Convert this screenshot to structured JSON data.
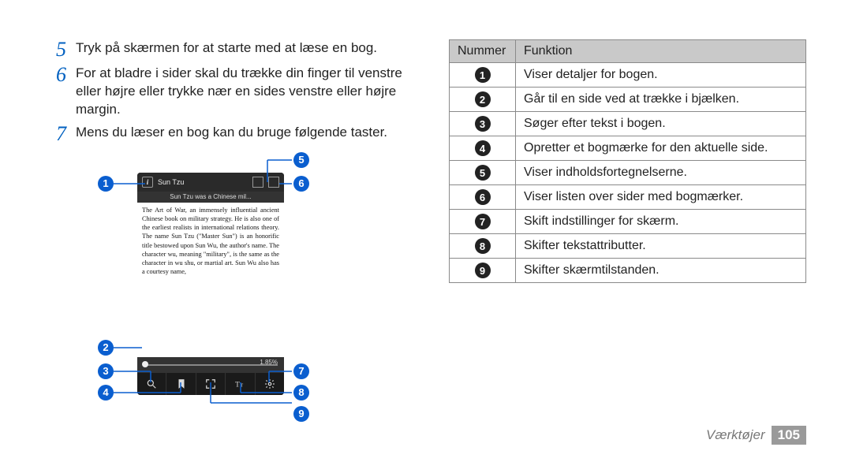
{
  "steps": [
    {
      "num": "5",
      "text": "Tryk på skærmen for at starte med at læse en bog."
    },
    {
      "num": "6",
      "text": "For at bladre i sider skal du trække din finger til venstre eller højre eller trykke nær en sides venstre eller højre margin."
    },
    {
      "num": "7",
      "text": "Mens du læser en bog kan du bruge følgende taster."
    }
  ],
  "phone": {
    "top_title": "Sun Tzu",
    "chapter": "Sun Tzu was a Chinese mil...",
    "body": "The Art of War, an immensely influential ancient Chinese book on military strategy. He is also one of the earliest realists in international relations theory.\nThe name Sun Tzu (\"Master Sun\") is an honorific title bestowed upon Sun Wu, the author's name. The character wu, meaning \"military\", is the same as the character in wu shu, or martial art. Sun Wu also has a courtesy name,",
    "progress": "1.85%"
  },
  "callouts": [
    "1",
    "2",
    "3",
    "4",
    "5",
    "6",
    "7",
    "8",
    "9"
  ],
  "table": {
    "head": {
      "num": "Nummer",
      "func": "Funktion"
    },
    "rows": [
      {
        "n": "1",
        "f": "Viser detaljer for bogen."
      },
      {
        "n": "2",
        "f": "Går til en side ved at trække i bjælken."
      },
      {
        "n": "3",
        "f": "Søger efter tekst i bogen."
      },
      {
        "n": "4",
        "f": "Opretter et bogmærke for den aktuelle side."
      },
      {
        "n": "5",
        "f": "Viser indholdsfortegnelserne."
      },
      {
        "n": "6",
        "f": "Viser listen over sider med bogmærker."
      },
      {
        "n": "7",
        "f": "Skift indstillinger for skærm."
      },
      {
        "n": "8",
        "f": "Skifter tekstattributter."
      },
      {
        "n": "9",
        "f": "Skifter skærmtilstanden."
      }
    ]
  },
  "footer": {
    "section": "Værktøjer",
    "page": "105"
  }
}
